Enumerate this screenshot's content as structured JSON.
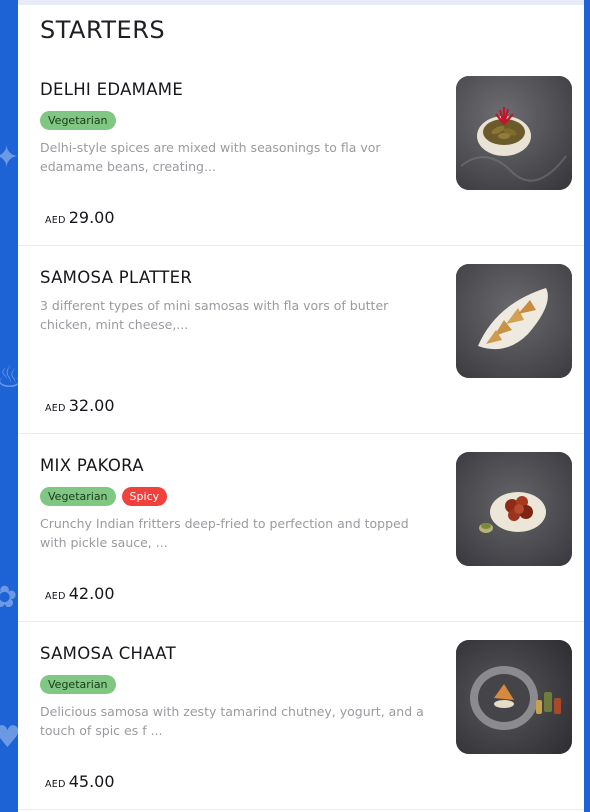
{
  "section": {
    "title": "STARTERS"
  },
  "items": [
    {
      "name": "DELHI EDAMAME",
      "tags": [
        "Vegetarian"
      ],
      "description": "Delhi-style spices are mixed with seasonings to fla vor edamame beans, creating...",
      "currency": "AED",
      "price": "29.00",
      "image_icon": "edamame-dish-photo"
    },
    {
      "name": "SAMOSA PLATTER",
      "tags": [],
      "description": "3 different types of mini samosas with fla vors of butter chicken, mint cheese,...",
      "currency": "AED",
      "price": "32.00",
      "image_icon": "samosa-platter-photo"
    },
    {
      "name": "MIX PAKORA",
      "tags": [
        "Vegetarian",
        "Spicy"
      ],
      "description": "Crunchy Indian fritters deep-fried to perfection and topped with pickle sauce, ...",
      "currency": "AED",
      "price": "42.00",
      "image_icon": "pakora-dish-photo"
    },
    {
      "name": "SAMOSA CHAAT",
      "tags": [
        "Vegetarian"
      ],
      "description": "Delicious samosa with zesty tamarind chutney, yogurt, and a touch of spic es f ...",
      "currency": "AED",
      "price": "45.00",
      "image_icon": "samosa-chaat-photo"
    }
  ],
  "colors": {
    "background": "#1d63d6",
    "vegetarian_tag": "#80c783",
    "spicy_tag": "#f2403c",
    "description_text": "#9a9aa0"
  }
}
